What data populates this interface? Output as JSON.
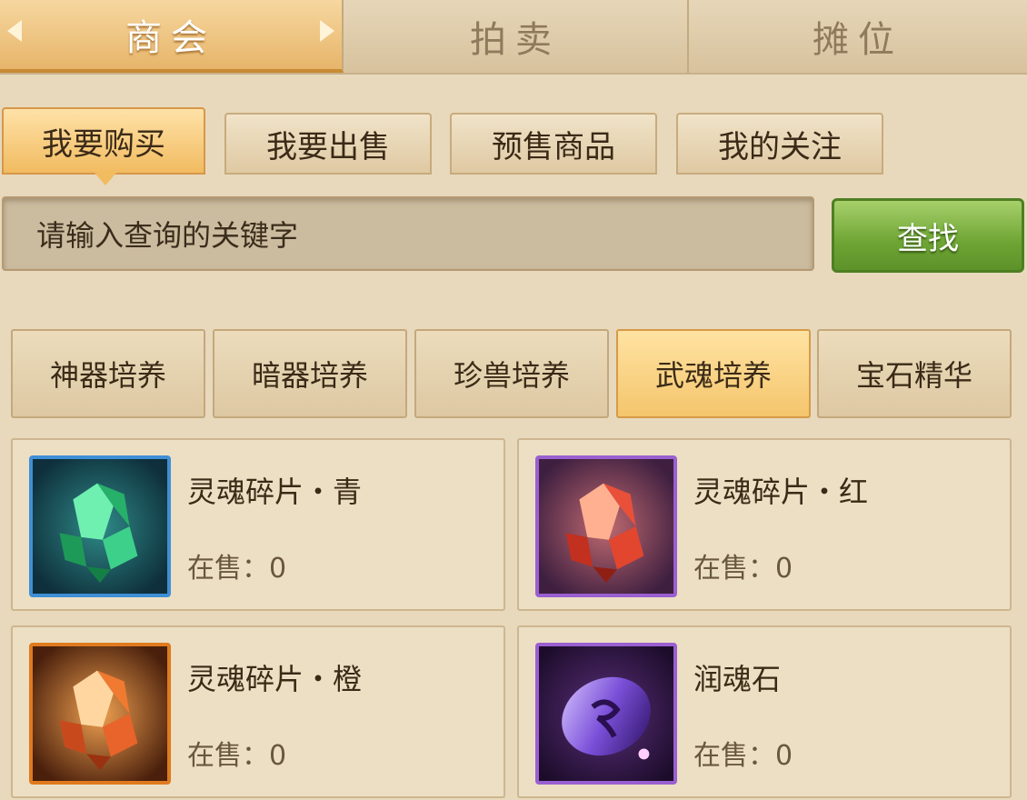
{
  "top_tabs": [
    {
      "label": "商会"
    },
    {
      "label": "拍卖"
    },
    {
      "label": "摊位"
    }
  ],
  "sub_tabs": [
    {
      "label": "我要购买"
    },
    {
      "label": "我要出售"
    },
    {
      "label": "预售商品"
    },
    {
      "label": "我的关注"
    }
  ],
  "search": {
    "placeholder": "请输入查询的关键字",
    "button_label": "查找"
  },
  "categories": [
    {
      "label": "神器培养"
    },
    {
      "label": "暗器培养"
    },
    {
      "label": "珍兽培养"
    },
    {
      "label": "武魂培养"
    },
    {
      "label": "宝石精华"
    }
  ],
  "items": [
    {
      "name": "灵魂碎片・青",
      "count_label": "在售：0",
      "frame_color": "#3f8fd6",
      "icon": "green-crystal-icon"
    },
    {
      "name": "灵魂碎片・红",
      "count_label": "在售：0",
      "frame_color": "#9a5fd0",
      "icon": "red-crystal-icon"
    },
    {
      "name": "灵魂碎片・橙",
      "count_label": "在售：0",
      "frame_color": "#e07a1e",
      "icon": "orange-crystal-icon"
    },
    {
      "name": "润魂石",
      "count_label": "在售：0",
      "frame_color": "#9a5fd0",
      "icon": "purple-stone-icon"
    }
  ]
}
